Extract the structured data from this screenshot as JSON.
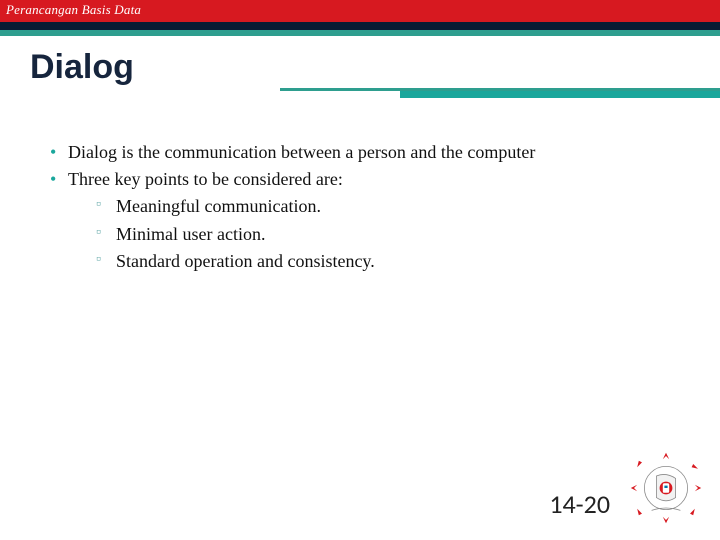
{
  "header": {
    "course_title": "Perancangan Basis Data"
  },
  "title": "Dialog",
  "bullets": {
    "b1": "Dialog is the communication between a person and the computer",
    "b2": "Three key points to be considered are:",
    "sub": {
      "s1": "Meaningful communication.",
      "s2": "Minimal user action.",
      "s3": "Standard operation and consistency."
    }
  },
  "footer": {
    "page": "14-20"
  }
}
